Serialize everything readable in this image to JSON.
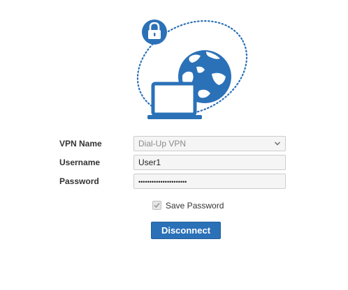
{
  "form": {
    "vpn_name_label": "VPN Name",
    "vpn_name_value": "Dial-Up VPN",
    "username_label": "Username",
    "username_value": "User1",
    "password_label": "Password",
    "password_mask": "••••••••••••••••••••••"
  },
  "save_password": {
    "label": "Save Password",
    "checked": true
  },
  "actions": {
    "disconnect_label": "Disconnect"
  },
  "icons": {
    "illustration": "vpn-globe-laptop-lock-icon",
    "lock": "lock-icon",
    "globe": "globe-icon",
    "laptop": "laptop-icon",
    "dropdown": "chevron-down-icon",
    "check": "check-icon"
  },
  "colors": {
    "accent": "#2b71b8",
    "field_bg": "#f5f5f5",
    "field_border": "#cccccc"
  }
}
